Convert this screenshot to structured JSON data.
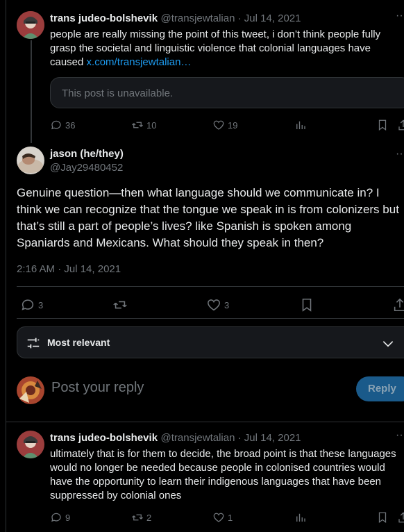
{
  "post1": {
    "name": "trans judeo-bolshevik",
    "handle_date": "@transjewtalian · Jul 14, 2021",
    "text": "people are really missing the point of this tweet, i don’t think people fully grasp the societal and linguistic  violence that colonial languages have caused ",
    "link": "x.com/transjewtalian…",
    "quote_unavailable": "This post is unavailable.",
    "replies": "36",
    "reposts": "10",
    "likes": "19"
  },
  "main_post": {
    "name": "jason (he/they)",
    "handle": "@Jay29480452",
    "text": "Genuine question—then what language should we communicate in? I think we can recognize that the tongue we speak in is from colonizers but that’s still a part of people’s lives? like Spanish is spoken among Spaniards and Mexicans. What should they speak in then?",
    "timestamp": "2:16 AM · Jul 14, 2021",
    "replies": "3",
    "likes": "3"
  },
  "sort": {
    "label": "Most relevant"
  },
  "composer": {
    "placeholder": "Post your reply",
    "button": "Reply"
  },
  "reply1": {
    "name": "trans judeo-bolshevik",
    "handle_date": "@transjewtalian · Jul 14, 2021",
    "text": "ultimately that is for them to decide, the broad point is that these languages would no longer be needed because people in colonised countries would have the opportunity to learn their indigenous languages that have been suppressed by colonial ones",
    "replies": "9",
    "reposts": "2",
    "likes": "1"
  },
  "colors": {
    "accent": "#1d9bf0",
    "muted": "#71767b",
    "border": "#2f3336",
    "reply_button_bg": "#1a5a8a"
  }
}
